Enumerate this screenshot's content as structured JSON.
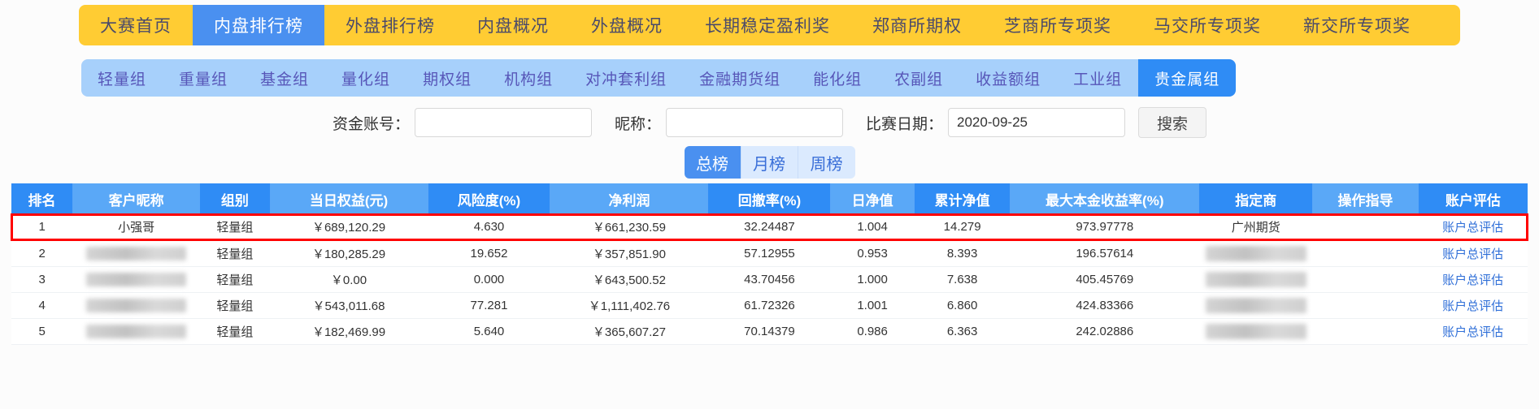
{
  "top_nav": {
    "items": [
      {
        "label": "大赛首页",
        "active": false
      },
      {
        "label": "内盘排行榜",
        "active": true
      },
      {
        "label": "外盘排行榜",
        "active": false
      },
      {
        "label": "内盘概况",
        "active": false
      },
      {
        "label": "外盘概况",
        "active": false
      },
      {
        "label": "长期稳定盈利奖",
        "active": false
      },
      {
        "label": "郑商所期权",
        "active": false
      },
      {
        "label": "芝商所专项奖",
        "active": false
      },
      {
        "label": "马交所专项奖",
        "active": false
      },
      {
        "label": "新交所专项奖",
        "active": false
      }
    ],
    "bg_color": "#ffcc33",
    "active_color": "#4a90f0"
  },
  "group_tabs": {
    "items": [
      {
        "label": "轻量组",
        "active": false
      },
      {
        "label": "重量组",
        "active": false
      },
      {
        "label": "基金组",
        "active": false
      },
      {
        "label": "量化组",
        "active": false
      },
      {
        "label": "期权组",
        "active": false
      },
      {
        "label": "机构组",
        "active": false
      },
      {
        "label": "对冲套利组",
        "active": false
      },
      {
        "label": "金融期货组",
        "active": false
      },
      {
        "label": "能化组",
        "active": false
      },
      {
        "label": "农副组",
        "active": false
      },
      {
        "label": "收益额组",
        "active": false
      },
      {
        "label": "工业组",
        "active": false
      },
      {
        "label": "贵金属组",
        "active": true
      }
    ],
    "bg_color": "#a7d0fb",
    "active_color": "#2f8cf5"
  },
  "search_form": {
    "account_label": "资金账号：",
    "account_value": "",
    "account_placeholder": "",
    "nick_label": "昵称：",
    "nick_value": "",
    "nick_placeholder": "",
    "date_label": "比赛日期：",
    "date_value": "2020-09-25",
    "search_button": "搜索"
  },
  "period_tabs": {
    "items": [
      {
        "label": "总榜",
        "active": true
      },
      {
        "label": "月榜",
        "active": false
      },
      {
        "label": "周榜",
        "active": false
      }
    ]
  },
  "table": {
    "headers": [
      "排名",
      "客户昵称",
      "组别",
      "当日权益(元)",
      "风险度(%)",
      "净利润",
      "回撤率(%)",
      "日净值",
      "累计净值",
      "最大本金收益率(%)",
      "指定商",
      "操作指导",
      "账户评估"
    ],
    "rows": [
      {
        "rank": "1",
        "nick": "小强哥",
        "nick_blurred": false,
        "group": "轻量组",
        "equity": "￥689,120.29",
        "risk": "4.630",
        "profit": "￥661,230.59",
        "drawdown": "32.24487",
        "daily_nav": "1.004",
        "cum_nav": "14.279",
        "max_return": "973.97778",
        "broker": "广州期货",
        "broker_blurred": false,
        "guide": "",
        "guide_blurred": false,
        "assess": "账户总评估",
        "highlighted": true
      },
      {
        "rank": "2",
        "nick": "",
        "nick_blurred": true,
        "group": "轻量组",
        "equity": "￥180,285.29",
        "risk": "19.652",
        "profit": "￥357,851.90",
        "drawdown": "57.12955",
        "daily_nav": "0.953",
        "cum_nav": "8.393",
        "max_return": "196.57614",
        "broker": "",
        "broker_blurred": true,
        "guide": "",
        "guide_blurred": false,
        "assess": "账户总评估",
        "highlighted": false
      },
      {
        "rank": "3",
        "nick": "",
        "nick_blurred": true,
        "group": "轻量组",
        "equity": "￥0.00",
        "risk": "0.000",
        "profit": "￥643,500.52",
        "drawdown": "43.70456",
        "daily_nav": "1.000",
        "cum_nav": "7.638",
        "max_return": "405.45769",
        "broker": "",
        "broker_blurred": true,
        "guide": "",
        "guide_blurred": false,
        "assess": "账户总评估",
        "highlighted": false
      },
      {
        "rank": "4",
        "nick": "",
        "nick_blurred": true,
        "group": "轻量组",
        "equity": "￥543,011.68",
        "risk": "77.281",
        "profit": "￥1,111,402.76",
        "drawdown": "61.72326",
        "daily_nav": "1.001",
        "cum_nav": "6.860",
        "max_return": "424.83366",
        "broker": "",
        "broker_blurred": true,
        "guide": "",
        "guide_blurred": false,
        "assess": "账户总评估",
        "highlighted": false
      },
      {
        "rank": "5",
        "nick": "",
        "nick_blurred": true,
        "group": "轻量组",
        "equity": "￥182,469.99",
        "risk": "5.640",
        "profit": "￥365,607.27",
        "drawdown": "70.14379",
        "daily_nav": "0.986",
        "cum_nav": "6.363",
        "max_return": "242.02886",
        "broker": "",
        "broker_blurred": true,
        "guide": "",
        "guide_blurred": false,
        "assess": "账户总评估",
        "highlighted": false
      }
    ]
  },
  "colors": {
    "header_blue": "#2f8cf5",
    "header_blue_alt": "#5aa8f7",
    "yellow": "#ffcc33",
    "light_blue": "#a7d0fb",
    "highlight_red": "#ff0000",
    "link_blue": "#2f6fd8",
    "nick_purple": "#7b4fc0"
  }
}
